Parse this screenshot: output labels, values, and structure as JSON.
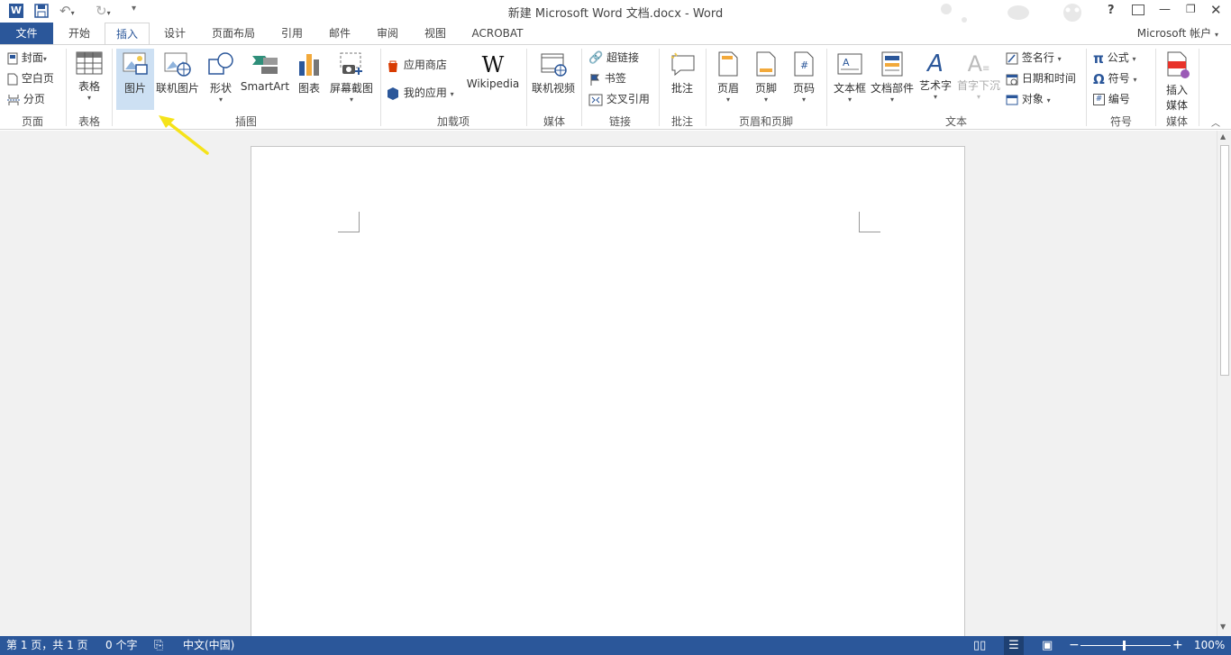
{
  "window": {
    "title": "新建 Microsoft Word 文档.docx - Word",
    "help": "?",
    "account": "Microsoft 帐户",
    "app_icon": "word-icon",
    "quick_access": [
      "save-icon",
      "undo-icon",
      "redo-icon",
      "customize-icon"
    ]
  },
  "tabs": [
    "文件",
    "开始",
    "插入",
    "设计",
    "页面布局",
    "引用",
    "邮件",
    "审阅",
    "视图",
    "ACROBAT"
  ],
  "active_tab": "插入",
  "ribbon": {
    "pages": {
      "label": "页面",
      "items": [
        "封面",
        "空白页",
        "分页"
      ]
    },
    "tables": {
      "label": "表格",
      "item": "表格"
    },
    "illustrations": {
      "label": "插图",
      "items": [
        "图片",
        "联机图片",
        "形状",
        "SmartArt",
        "图表",
        "屏幕截图"
      ],
      "highlighted": "图片"
    },
    "addins": {
      "label": "加载项",
      "store": "应用商店",
      "myapps": "我的应用",
      "wikipedia": "Wikipedia"
    },
    "media": {
      "label": "媒体",
      "item": "联机视频"
    },
    "links": {
      "label": "链接",
      "items": [
        "超链接",
        "书签",
        "交叉引用"
      ]
    },
    "comments": {
      "label": "批注",
      "item": "批注"
    },
    "header_footer": {
      "label": "页眉和页脚",
      "items": [
        "页眉",
        "页脚",
        "页码"
      ]
    },
    "text": {
      "label": "文本",
      "items": [
        "文本框",
        "文档部件",
        "艺术字",
        "首字下沉"
      ],
      "small_items": [
        "签名行",
        "日期和时间",
        "对象"
      ]
    },
    "symbols": {
      "label": "符号",
      "items": [
        "公式",
        "符号",
        "编号"
      ]
    },
    "insert_media": {
      "label": "媒体",
      "item_line1": "插入",
      "item_line2": "媒体"
    }
  },
  "statusbar": {
    "page": "第 1 页，共 1 页",
    "words": "0 个字",
    "language": "中文(中国)",
    "zoom": "100%",
    "zoom_minus": "−",
    "zoom_plus": "+"
  },
  "colors": {
    "accent": "#2b579a",
    "highlight": "#cde0f3",
    "arrow": "#f5e31a"
  }
}
